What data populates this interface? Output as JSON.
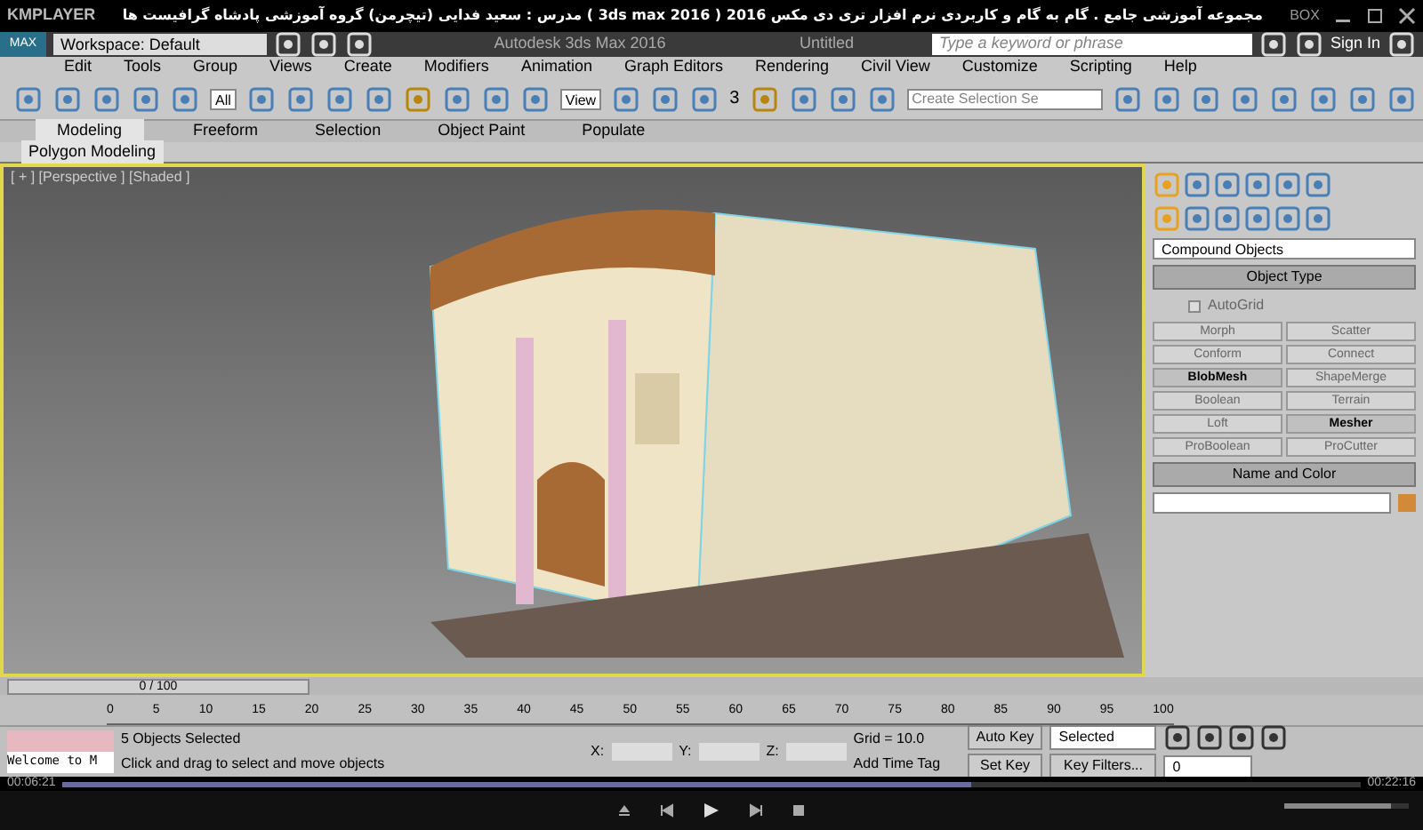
{
  "player": {
    "name": "KMPLAYER",
    "title": "مجموعه آموزشی جامع . گام به گام و کاربردی نرم افزار تری دی مکس 2016 ( 3ds max 2016 ) مدرس : سعید فدایی (تیچرمن) گروه آموزشی پادشاه گرافیست ها",
    "box": "BOX",
    "elapsed": "00:06:21",
    "total": "00:22:16",
    "progress": {
      "level": 0.7
    },
    "volume": {
      "level": 0.85
    }
  },
  "app": {
    "workspace": "Workspace: Default",
    "title": "Autodesk 3ds Max 2016",
    "document": "Untitled",
    "search": {
      "placeholder": "Type a keyword or phrase"
    },
    "sign_in": "Sign In",
    "logo": "MAX"
  },
  "menu": [
    "Edit",
    "Tools",
    "Group",
    "Views",
    "Create",
    "Modifiers",
    "Animation",
    "Graph Editors",
    "Rendering",
    "Civil View",
    "Customize",
    "Scripting",
    "Help"
  ],
  "toolbar": {
    "filter": "All",
    "coordinate": "View",
    "snap": "3",
    "selection_set": {
      "placeholder": "Create Selection Se"
    }
  },
  "ribbon": {
    "tabs": [
      {
        "label": "Modeling",
        "selected": true
      },
      {
        "label": "Freeform",
        "selected": false
      },
      {
        "label": "Selection",
        "selected": false
      },
      {
        "label": "Object Paint",
        "selected": false
      },
      {
        "label": "Populate",
        "selected": false
      }
    ],
    "panel": "Polygon Modeling"
  },
  "viewport": {
    "label": "[ + ] [Perspective ] [Shaded ]"
  },
  "command_panel": {
    "category": "Compound Objects",
    "rollout": "Object Type",
    "autogrid": {
      "label": "AutoGrid",
      "checked": false
    },
    "buttons": [
      {
        "label": "Morph",
        "disabled": true
      },
      {
        "label": "Scatter",
        "disabled": true
      },
      {
        "label": "Conform",
        "disabled": true
      },
      {
        "label": "Connect",
        "disabled": true
      },
      {
        "label": "BlobMesh",
        "disabled": false
      },
      {
        "label": "ShapeMerge",
        "disabled": true
      },
      {
        "label": "Boolean",
        "disabled": true
      },
      {
        "label": "Terrain",
        "disabled": true
      },
      {
        "label": "Loft",
        "disabled": true
      },
      {
        "label": "Mesher",
        "disabled": false
      },
      {
        "label": "ProBoolean",
        "disabled": true
      },
      {
        "label": "ProCutter",
        "disabled": true
      }
    ],
    "name_rollout": "Name and Color",
    "color": "#d08a3a"
  },
  "timeline": {
    "slider": {
      "label": "0 / 100",
      "level": 0
    },
    "ticks": [
      "0",
      "5",
      "10",
      "15",
      "20",
      "25",
      "30",
      "35",
      "40",
      "45",
      "50",
      "55",
      "60",
      "65",
      "70",
      "75",
      "80",
      "85",
      "90",
      "95",
      "100"
    ]
  },
  "status": {
    "listener": "Welcome to M",
    "selection": "5 Objects Selected",
    "prompt": "Click and drag to select and move objects",
    "x": "X:",
    "y": "Y:",
    "z": "Z:",
    "grid": "Grid = 10.0",
    "time_tag": "Add Time Tag",
    "auto_key": "Auto Key",
    "set_key": "Set Key",
    "key_mode": "Selected",
    "key_filters": "Key Filters...",
    "frame": "0"
  }
}
